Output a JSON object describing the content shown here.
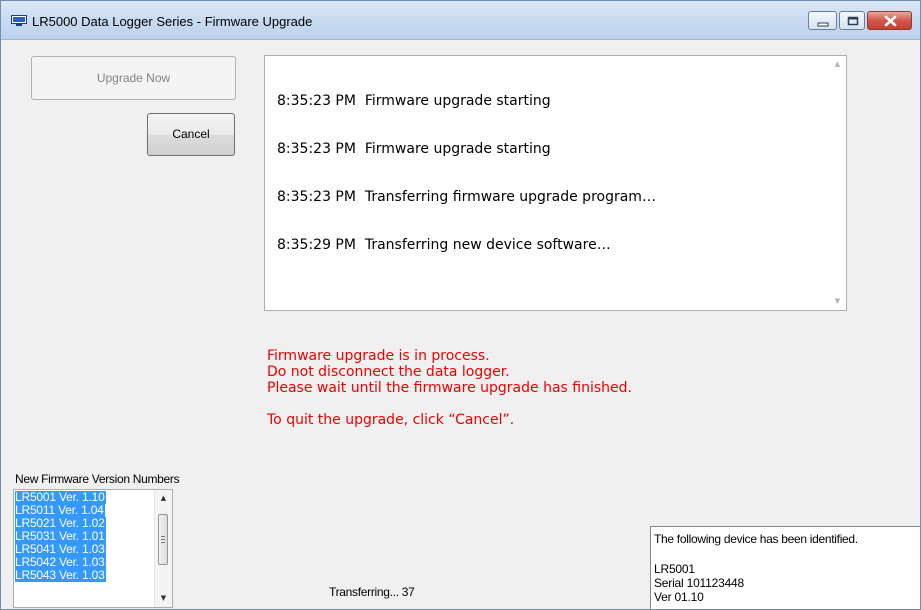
{
  "window": {
    "title": "LR5000 Data Logger Series - Firmware Upgrade",
    "controls": [
      "minimize",
      "maximize",
      "close"
    ]
  },
  "buttons": {
    "upgrade_now": "Upgrade Now",
    "cancel": "Cancel"
  },
  "log": {
    "lines": [
      "8:35:23 PM  Firmware upgrade starting",
      "8:35:23 PM  Firmware upgrade starting",
      "8:35:23 PM  Transferring firmware upgrade program…",
      "8:35:29 PM  Transferring new device software…"
    ]
  },
  "warning": {
    "color": "#ee0000",
    "line1": "Firmware upgrade is in process.",
    "line2": "Do not disconnect the data logger.",
    "line3": "Please wait until the firmware upgrade has finished.",
    "line4": "To quit the upgrade, click “Cancel”."
  },
  "firmware": {
    "label": "New Firmware Version Numbers",
    "items": [
      "LR5001 Ver. 1.10",
      "LR5011 Ver. 1.04",
      "LR5021 Ver. 1.02",
      "LR5031 Ver. 1.01",
      "LR5041 Ver. 1.03",
      "LR5042 Ver. 1.03",
      "LR5043 Ver. 1.03"
    ],
    "selection_color": "#3399ff"
  },
  "progress": {
    "text": "Transferring... 37"
  },
  "device": {
    "heading": "The following device has been identified.",
    "model": "LR5001",
    "serial": "Serial 101123448",
    "version": "Ver 01.10"
  }
}
